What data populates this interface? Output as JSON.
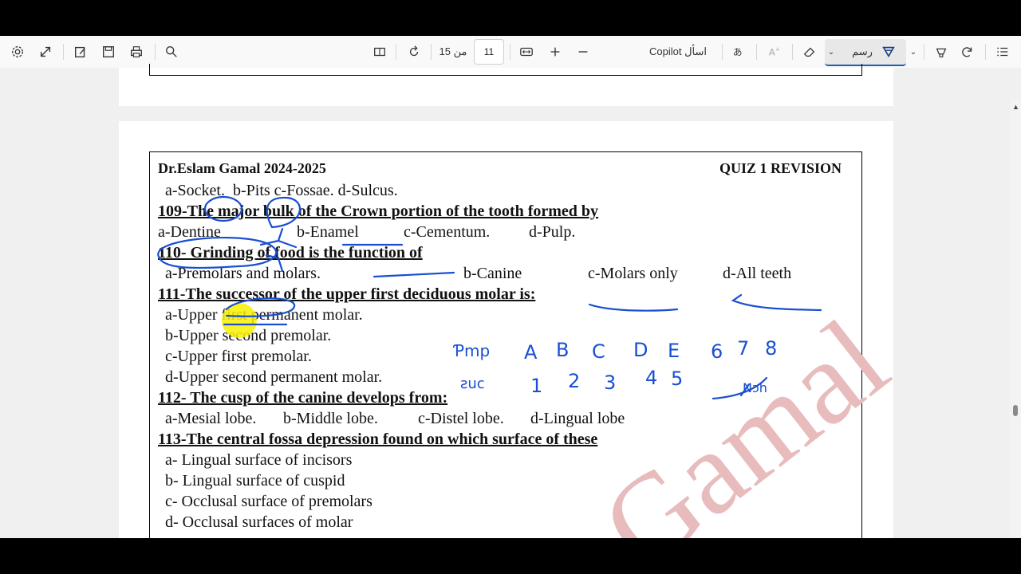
{
  "toolbar": {
    "page_total": "15 من",
    "page_current": "11",
    "copilot": "Copilot اسأل",
    "draw": "رسم"
  },
  "doc": {
    "header_left": "Dr.Eslam Gamal 2024-2025",
    "header_right": "QUIZ 1 REVISION",
    "lines": [
      {
        "a": "a-Socket.",
        "b": "b-Pits",
        "c": "c-Fossae.",
        "d": "d-Sulcus."
      },
      {
        "q": "109-The major bulk of the Crown portion of the tooth formed by"
      },
      {
        "a": "a-Dentine",
        "b": "b-Enamel",
        "c": "c-Cementum.",
        "d": "d-Pulp."
      },
      {
        "q": "110- Grinding of food is the function of"
      },
      {
        "a": "a-Premolars and molars.",
        "b": "b-Canine",
        "c": "c-Molars only",
        "d": "d-All teeth"
      },
      {
        "q": "111-The successor of the upper first deciduous molar is:"
      },
      {
        "a": "a-Upper first permanent molar."
      },
      {
        "a": "b-Upper second premolar."
      },
      {
        "a": "c-Upper first premolar."
      },
      {
        "a": "d-Upper second permanent molar."
      },
      {
        "q": "112- The cusp of the canine develops from:"
      },
      {
        "a": "a-Mesial lobe.",
        "b": "b-Middle lobe.",
        "c": "c-Distel lobe.",
        "d": "d-Lingual lobe"
      },
      {
        "q": "113-The central fossa depression found on which surface of these"
      },
      {
        "a": "a- Lingual surface of incisors"
      },
      {
        "a": "b- Lingual surface of cuspid"
      },
      {
        "a": "c- Occlusal surface of premolars"
      },
      {
        "a": "d- Occlusal surfaces of molar"
      }
    ],
    "watermark": "Gamal",
    "handwriting": {
      "row1_letters": [
        "A",
        "B",
        "C",
        "D",
        "E"
      ],
      "row1_numbers": [
        "6",
        "7",
        "8"
      ],
      "row2_numbers": [
        "1",
        "2",
        "3",
        "4",
        "5"
      ]
    }
  },
  "colors": {
    "ink": "#1a4fd1",
    "highlight": "#f7f000",
    "watermark": "#e8bcbc"
  }
}
